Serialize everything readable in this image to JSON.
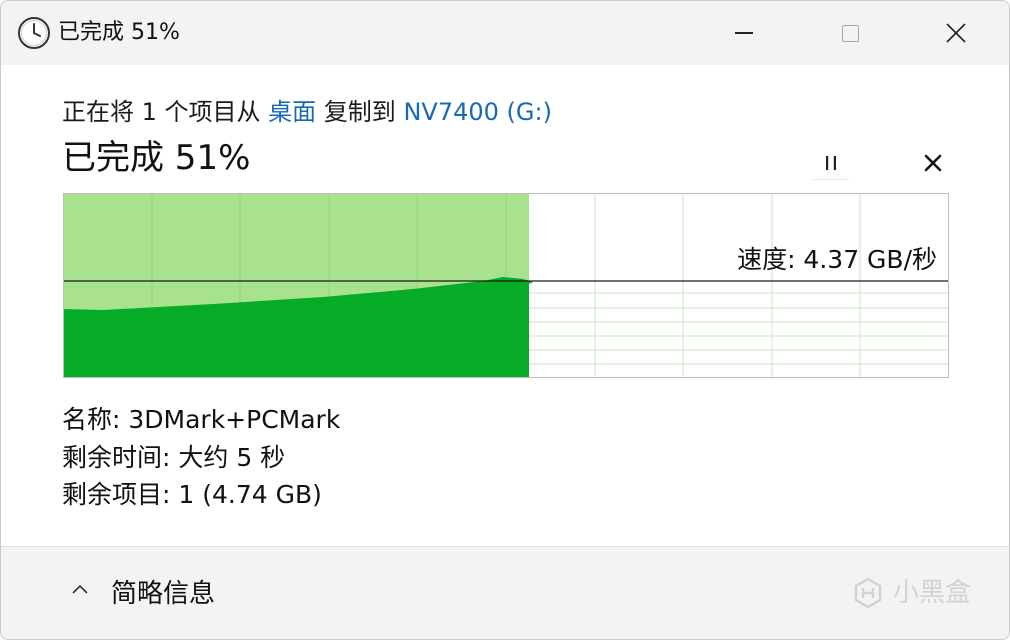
{
  "window": {
    "title": "已完成 51%"
  },
  "header": {
    "prefix": "正在将 1 个项目从",
    "source": "桌面",
    "middle": "复制到",
    "destination": "NV7400 (G:)",
    "status": "已完成 51%"
  },
  "graph": {
    "progress_fraction": 0.51,
    "speed_label": "速度: 4.37 GB/秒",
    "colors": {
      "done_light": "#a8e28e",
      "done_dark": "#06ac27",
      "grid": "#c5e8c2"
    }
  },
  "details": {
    "name": "名称:  3DMark+PCMark",
    "time_remaining": "剩余时间:  大约 5 秒",
    "items_remaining": "剩余项目:  1 (4.74 GB)"
  },
  "footer": {
    "toggle_label": "简略信息",
    "watermark": "小黑盒"
  },
  "icons": {
    "title": "clock-icon",
    "pause": "pause-icon",
    "cancel": "close-icon",
    "toggle": "chevron-up-icon"
  }
}
